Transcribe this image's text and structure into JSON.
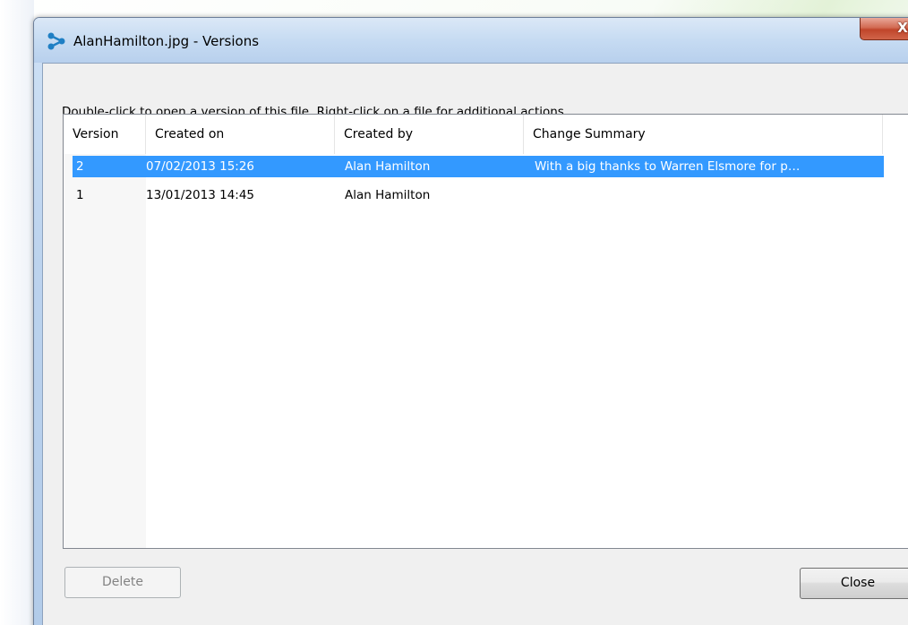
{
  "window": {
    "title": "AlanHamilton.jpg - Versions",
    "close_glyph": "X"
  },
  "hint": "Double-click to open a version of this file. Right-click on a file for additional actions.",
  "table": {
    "columns": [
      "Version",
      "Created on",
      "Created by",
      "Change Summary"
    ],
    "rows": [
      {
        "version": "2",
        "created_on": "07/02/2013 15:26",
        "created_by": "Alan Hamilton",
        "summary": "With a big thanks to Warren Elsmore for p…",
        "selected": true
      },
      {
        "version": "1",
        "created_on": "13/01/2013 14:45",
        "created_by": "Alan Hamilton",
        "summary": "",
        "selected": false
      }
    ]
  },
  "buttons": {
    "delete": "Delete",
    "close": "Close"
  },
  "colors": {
    "selection": "#3399ff",
    "close_button": "#c0452a"
  },
  "icons": {
    "title": "versions-branch-icon"
  }
}
